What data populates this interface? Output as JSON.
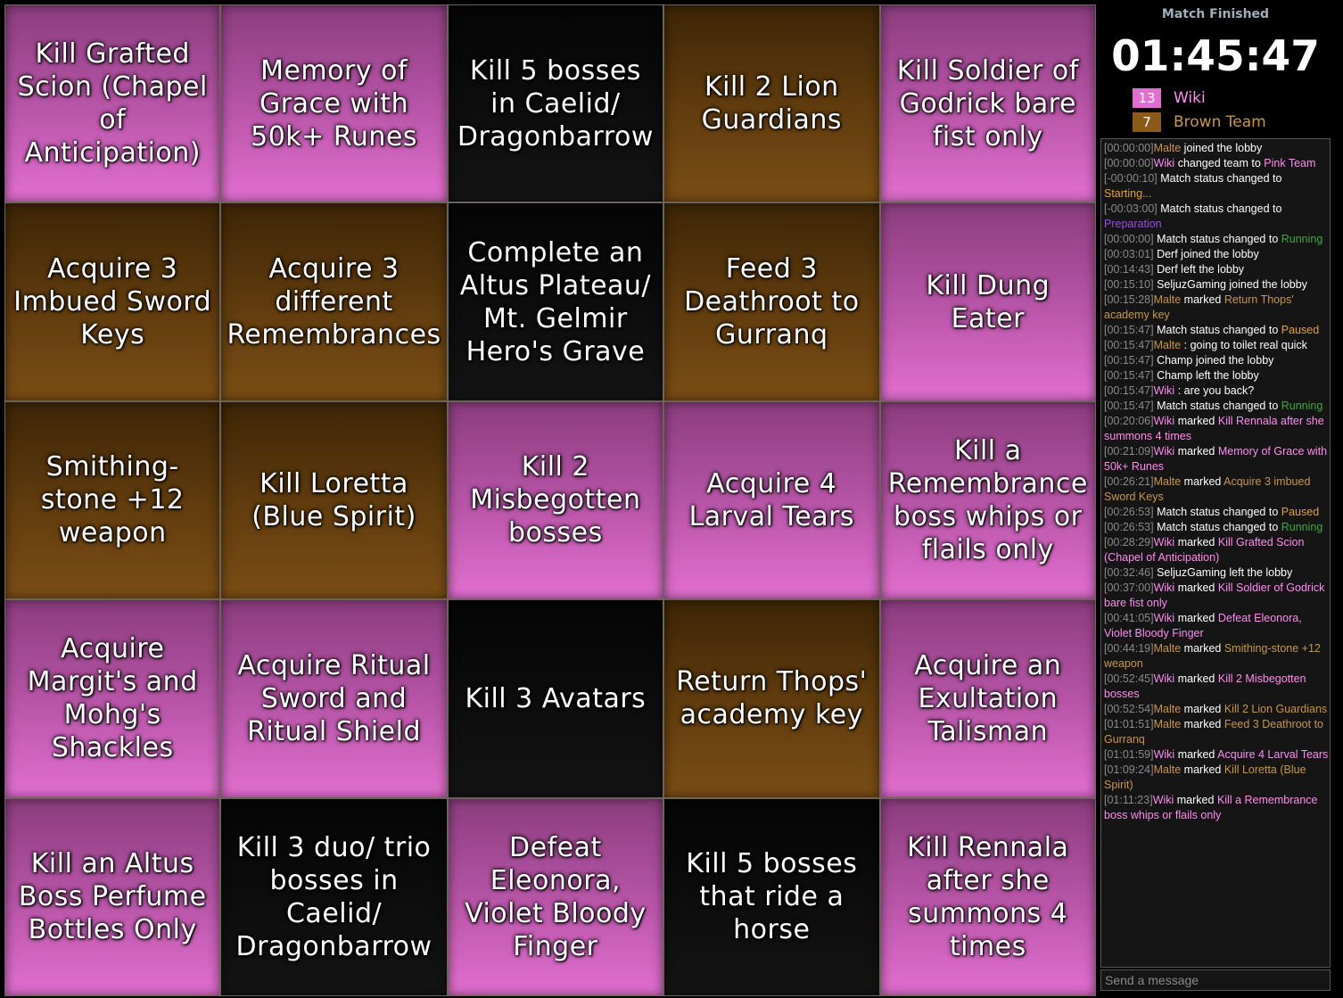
{
  "colors": {
    "pink": "#e26fd0",
    "brown": "#8b5a16",
    "none": "#0c0c0c",
    "orange": "#e0a23a",
    "purple": "#9a4ee0",
    "green": "#3ea83e",
    "brown_text": "#c8964a"
  },
  "board": [
    {
      "text": "Kill Grafted Scion (Chapel of Anticipation)",
      "team": "pink"
    },
    {
      "text": "Memory of Grace with 50k+ Runes",
      "team": "pink"
    },
    {
      "text": "Kill 5 bosses in Caelid/ Dragonbarrow",
      "team": "none"
    },
    {
      "text": "Kill 2 Lion Guardians",
      "team": "brown"
    },
    {
      "text": "Kill Soldier of Godrick bare fist only",
      "team": "pink"
    },
    {
      "text": "Acquire 3 Imbued Sword Keys",
      "team": "brown"
    },
    {
      "text": "Acquire 3 different Remembrances",
      "team": "brown"
    },
    {
      "text": "Complete an Altus Plateau/ Mt. Gelmir Hero's Grave",
      "team": "none"
    },
    {
      "text": "Feed 3 Deathroot to Gurranq",
      "team": "brown"
    },
    {
      "text": "Kill Dung Eater",
      "team": "pink"
    },
    {
      "text": "Smithing-stone +12 weapon",
      "team": "brown"
    },
    {
      "text": "Kill Loretta (Blue Spirit)",
      "team": "brown"
    },
    {
      "text": "Kill 2 Misbegotten bosses",
      "team": "pink"
    },
    {
      "text": "Acquire 4 Larval Tears",
      "team": "pink"
    },
    {
      "text": "Kill a Remembrance boss whips or flails only",
      "team": "pink"
    },
    {
      "text": "Acquire Margit's and Mohg's Shackles",
      "team": "pink"
    },
    {
      "text": "Acquire Ritual Sword and Ritual Shield",
      "team": "pink"
    },
    {
      "text": "Kill 3 Avatars",
      "team": "none"
    },
    {
      "text": "Return Thops' academy key",
      "team": "brown"
    },
    {
      "text": "Acquire an Exultation Talisman",
      "team": "pink"
    },
    {
      "text": "Kill an Altus Boss Perfume Bottles Only",
      "team": "pink"
    },
    {
      "text": "Kill 3 duo/ trio bosses in Caelid/ Dragonbarrow",
      "team": "none"
    },
    {
      "text": "Defeat Eleonora, Violet Bloody Finger",
      "team": "pink"
    },
    {
      "text": "Kill 5 bosses that ride a horse",
      "team": "none"
    },
    {
      "text": "Kill Rennala after she summons 4 times",
      "team": "pink"
    }
  ],
  "match_status": "Match Finished",
  "timer": "01:45:47",
  "teams": [
    {
      "score": "13",
      "name": "Wiki",
      "color": "#e26fd0",
      "text_color": "#ff8cf0"
    },
    {
      "score": "7",
      "name": "Brown Team",
      "color": "#8b5a16",
      "text_color": "#c8964a"
    }
  ],
  "chat": [
    {
      "ts": "[00:00:00]",
      "parts": [
        {
          "t": "Malte",
          "c": "brown_text"
        },
        {
          "t": " joined the lobby"
        }
      ]
    },
    {
      "ts": "[00:00:00]",
      "parts": [
        {
          "t": "Wiki",
          "c": "pink"
        },
        {
          "t": " changed team to "
        },
        {
          "t": "Pink Team",
          "c": "pink"
        }
      ]
    },
    {
      "ts": "[-00:00:10]",
      "parts": [
        {
          "t": " Match status changed to "
        },
        {
          "t": "Starting...",
          "c": "orange"
        }
      ]
    },
    {
      "ts": "[-00:03:00]",
      "parts": [
        {
          "t": " Match status changed to "
        },
        {
          "t": "Preparation",
          "c": "purple"
        }
      ]
    },
    {
      "ts": "[00:00:00]",
      "parts": [
        {
          "t": " Match status changed to "
        },
        {
          "t": "Running",
          "c": "green"
        }
      ]
    },
    {
      "ts": "[00:03:01]",
      "parts": [
        {
          "t": " Derf joined the lobby"
        }
      ]
    },
    {
      "ts": "[00:14:43]",
      "parts": [
        {
          "t": " Derf left the lobby"
        }
      ]
    },
    {
      "ts": "[00:15:10]",
      "parts": [
        {
          "t": " SeljuzGaming joined the lobby"
        }
      ]
    },
    {
      "ts": "[00:15:28]",
      "parts": [
        {
          "t": "Malte",
          "c": "brown_text"
        },
        {
          "t": " marked "
        },
        {
          "t": "Return Thops' academy key",
          "c": "brown_text"
        }
      ]
    },
    {
      "ts": "[00:15:47]",
      "parts": [
        {
          "t": " Match status changed to "
        },
        {
          "t": "Paused",
          "c": "orange"
        }
      ]
    },
    {
      "ts": "[00:15:47]",
      "parts": [
        {
          "t": "Malte",
          "c": "brown_text"
        },
        {
          "t": " : going to toilet real quick"
        }
      ]
    },
    {
      "ts": "[00:15:47]",
      "parts": [
        {
          "t": " Champ joined the lobby"
        }
      ]
    },
    {
      "ts": "[00:15:47]",
      "parts": [
        {
          "t": " Champ left the lobby"
        }
      ]
    },
    {
      "ts": "[00:15:47]",
      "parts": [
        {
          "t": "Wiki",
          "c": "pink"
        },
        {
          "t": " : are you back?"
        }
      ]
    },
    {
      "ts": "[00:15:47]",
      "parts": [
        {
          "t": " Match status changed to "
        },
        {
          "t": "Running",
          "c": "green"
        }
      ]
    },
    {
      "ts": "[00:20:06]",
      "parts": [
        {
          "t": "Wiki",
          "c": "pink"
        },
        {
          "t": " marked "
        },
        {
          "t": "Kill Rennala after she summons 4 times",
          "c": "pink"
        }
      ]
    },
    {
      "ts": "[00:21:09]",
      "parts": [
        {
          "t": "Wiki",
          "c": "pink"
        },
        {
          "t": " marked "
        },
        {
          "t": "Memory of Grace with 50k+ Runes",
          "c": "pink"
        }
      ]
    },
    {
      "ts": "[00:26:21]",
      "parts": [
        {
          "t": "Malte",
          "c": "brown_text"
        },
        {
          "t": " marked "
        },
        {
          "t": "Acquire 3 imbued Sword Keys",
          "c": "brown_text"
        }
      ]
    },
    {
      "ts": "[00:26:53]",
      "parts": [
        {
          "t": " Match status changed to "
        },
        {
          "t": "Paused",
          "c": "orange"
        }
      ]
    },
    {
      "ts": "[00:26:53]",
      "parts": [
        {
          "t": " Match status changed to "
        },
        {
          "t": "Running",
          "c": "green"
        }
      ]
    },
    {
      "ts": "[00:28:29]",
      "parts": [
        {
          "t": "Wiki",
          "c": "pink"
        },
        {
          "t": " marked "
        },
        {
          "t": "Kill Grafted Scion (Chapel of Anticipation)",
          "c": "pink"
        }
      ]
    },
    {
      "ts": "[00:32:46]",
      "parts": [
        {
          "t": " SeljuzGaming left the lobby"
        }
      ]
    },
    {
      "ts": "[00:37:00]",
      "parts": [
        {
          "t": "Wiki",
          "c": "pink"
        },
        {
          "t": " marked "
        },
        {
          "t": "Kill Soldier of Godrick bare fist only",
          "c": "pink"
        }
      ]
    },
    {
      "ts": "[00:41:05]",
      "parts": [
        {
          "t": "Wiki",
          "c": "pink"
        },
        {
          "t": " marked "
        },
        {
          "t": "Defeat Eleonora, Violet Bloody Finger",
          "c": "pink"
        }
      ]
    },
    {
      "ts": "[00:44:19]",
      "parts": [
        {
          "t": "Malte",
          "c": "brown_text"
        },
        {
          "t": " marked "
        },
        {
          "t": "Smithing-stone +12 weapon",
          "c": "brown_text"
        }
      ]
    },
    {
      "ts": "[00:52:45]",
      "parts": [
        {
          "t": "Wiki",
          "c": "pink"
        },
        {
          "t": " marked "
        },
        {
          "t": "Kill 2 Misbegotten bosses",
          "c": "pink"
        }
      ]
    },
    {
      "ts": "[00:52:54]",
      "parts": [
        {
          "t": "Malte",
          "c": "brown_text"
        },
        {
          "t": " marked "
        },
        {
          "t": "Kill 2 Lion Guardians",
          "c": "brown_text"
        }
      ]
    },
    {
      "ts": "[01:01:51]",
      "parts": [
        {
          "t": "Malte",
          "c": "brown_text"
        },
        {
          "t": " marked "
        },
        {
          "t": "Feed 3 Deathroot to Gurranq",
          "c": "brown_text"
        }
      ]
    },
    {
      "ts": "[01:01:59]",
      "parts": [
        {
          "t": "Wiki",
          "c": "pink"
        },
        {
          "t": " marked "
        },
        {
          "t": "Acquire 4 Larval Tears",
          "c": "pink"
        }
      ]
    },
    {
      "ts": "[01:09:24]",
      "parts": [
        {
          "t": "Malte",
          "c": "brown_text"
        },
        {
          "t": " marked "
        },
        {
          "t": "Kill Loretta (Blue Spirit)",
          "c": "brown_text"
        }
      ]
    },
    {
      "ts": "[01:11:23]",
      "parts": [
        {
          "t": "Wiki",
          "c": "pink"
        },
        {
          "t": " marked "
        },
        {
          "t": "Kill a Remembrance boss whips or flails only",
          "c": "pink"
        }
      ]
    }
  ],
  "chat_input": {
    "placeholder": "Send a message"
  }
}
